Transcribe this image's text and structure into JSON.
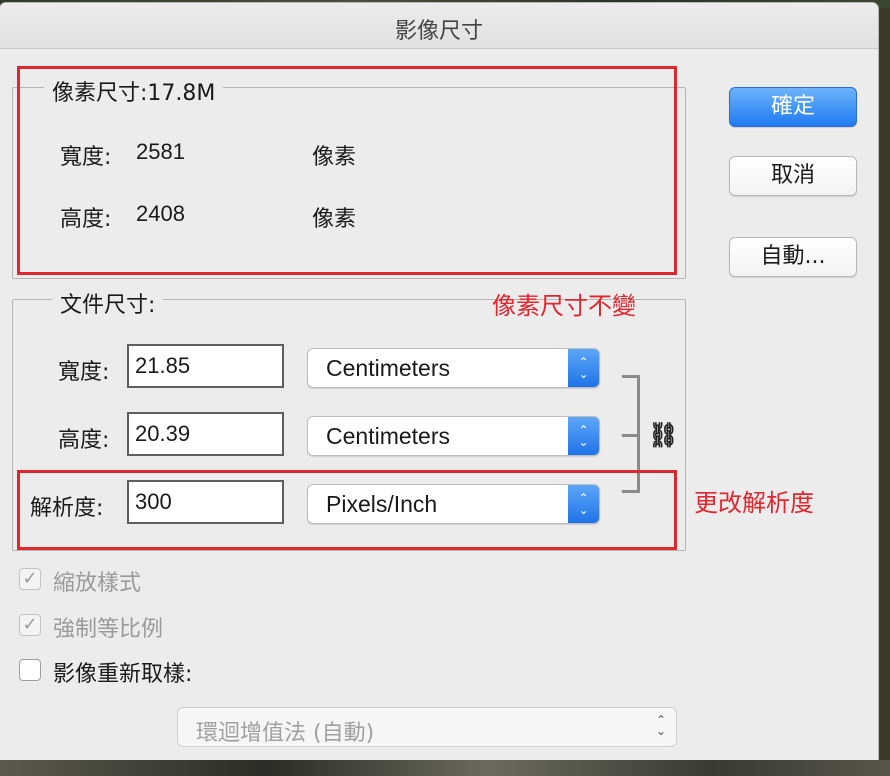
{
  "dialog": {
    "title": "影像尺寸"
  },
  "pixel_dimensions": {
    "legend": "像素尺寸:17.8M",
    "width_label": "寬度:",
    "width_value": "2581",
    "width_unit": "像素",
    "height_label": "高度:",
    "height_value": "2408",
    "height_unit": "像素"
  },
  "document_size": {
    "legend": "文件尺寸:",
    "width_label": "寬度:",
    "width_value": "21.85",
    "width_unit": "Centimeters",
    "height_label": "高度:",
    "height_value": "20.39",
    "height_unit": "Centimeters",
    "resolution_label": "解析度:",
    "resolution_value": "300",
    "resolution_unit": "Pixels/Inch"
  },
  "buttons": {
    "ok": "確定",
    "cancel": "取消",
    "auto": "自動..."
  },
  "options": {
    "scale_styles": {
      "label": "縮放樣式",
      "checked": true,
      "enabled": false
    },
    "constrain_proportions": {
      "label": "強制等比例",
      "checked": true,
      "enabled": false
    },
    "resample": {
      "label": "影像重新取樣:",
      "checked": false,
      "enabled": true
    },
    "interpolation": "環迴增值法 (自動)"
  },
  "annotations": {
    "pixels_unchanged": "像素尺寸不變",
    "change_resolution": "更改解析度",
    "color": "#e0262e"
  },
  "colors": {
    "accent": "#1f7bf2",
    "dialog_bg": "#ececec"
  }
}
